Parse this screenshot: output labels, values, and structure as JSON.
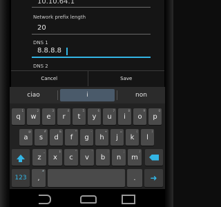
{
  "dialog": {
    "gateway_value": "10.10.64.1",
    "prefix_label": "Network prefix length",
    "prefix_value": "20",
    "dns1_label": "DNS 1",
    "dns1_value": "8.8.8.8",
    "dns2_label": "DNS 2",
    "cancel_label": "Cancel",
    "save_label": "Save"
  },
  "keyboard": {
    "suggestions": [
      "ciao",
      "i",
      "non"
    ],
    "row1": [
      {
        "k": "q",
        "s": "1"
      },
      {
        "k": "w",
        "s": "2"
      },
      {
        "k": "e",
        "s": "3"
      },
      {
        "k": "r",
        "s": "4"
      },
      {
        "k": "t",
        "s": "5"
      },
      {
        "k": "y",
        "s": "6"
      },
      {
        "k": "u",
        "s": "7"
      },
      {
        "k": "i",
        "s": "8"
      },
      {
        "k": "o",
        "s": "9"
      },
      {
        "k": "p",
        "s": "0"
      }
    ],
    "row2": [
      {
        "k": "a",
        "s": "@"
      },
      {
        "k": "s",
        "s": "#"
      },
      {
        "k": "d",
        "s": "&"
      },
      {
        "k": "f",
        "s": "*"
      },
      {
        "k": "g",
        "s": "-"
      },
      {
        "k": "h",
        "s": "+"
      },
      {
        "k": "j",
        "s": "="
      },
      {
        "k": "k",
        "s": "("
      },
      {
        "k": "l",
        "s": ")"
      }
    ],
    "row3": [
      {
        "k": "z",
        "s": "_"
      },
      {
        "k": "x",
        "s": "$"
      },
      {
        "k": "c",
        "s": "\""
      },
      {
        "k": "v",
        "s": "'"
      },
      {
        "k": "b",
        "s": ":"
      },
      {
        "k": "n",
        "s": ";"
      },
      {
        "k": "m",
        "s": "/"
      }
    ],
    "numbers_label": "123",
    "comma": ",",
    "period": "."
  },
  "icons": {
    "shift": "shift-icon",
    "delete": "backspace-icon",
    "enter": "enter-icon",
    "mic": "mic-icon",
    "back": "back-icon",
    "home": "home-icon",
    "recent": "recent-apps-icon"
  },
  "colors": {
    "accent": "#33b5e5",
    "key": "#4a4a4a",
    "keyboard_bg": "#222222"
  }
}
